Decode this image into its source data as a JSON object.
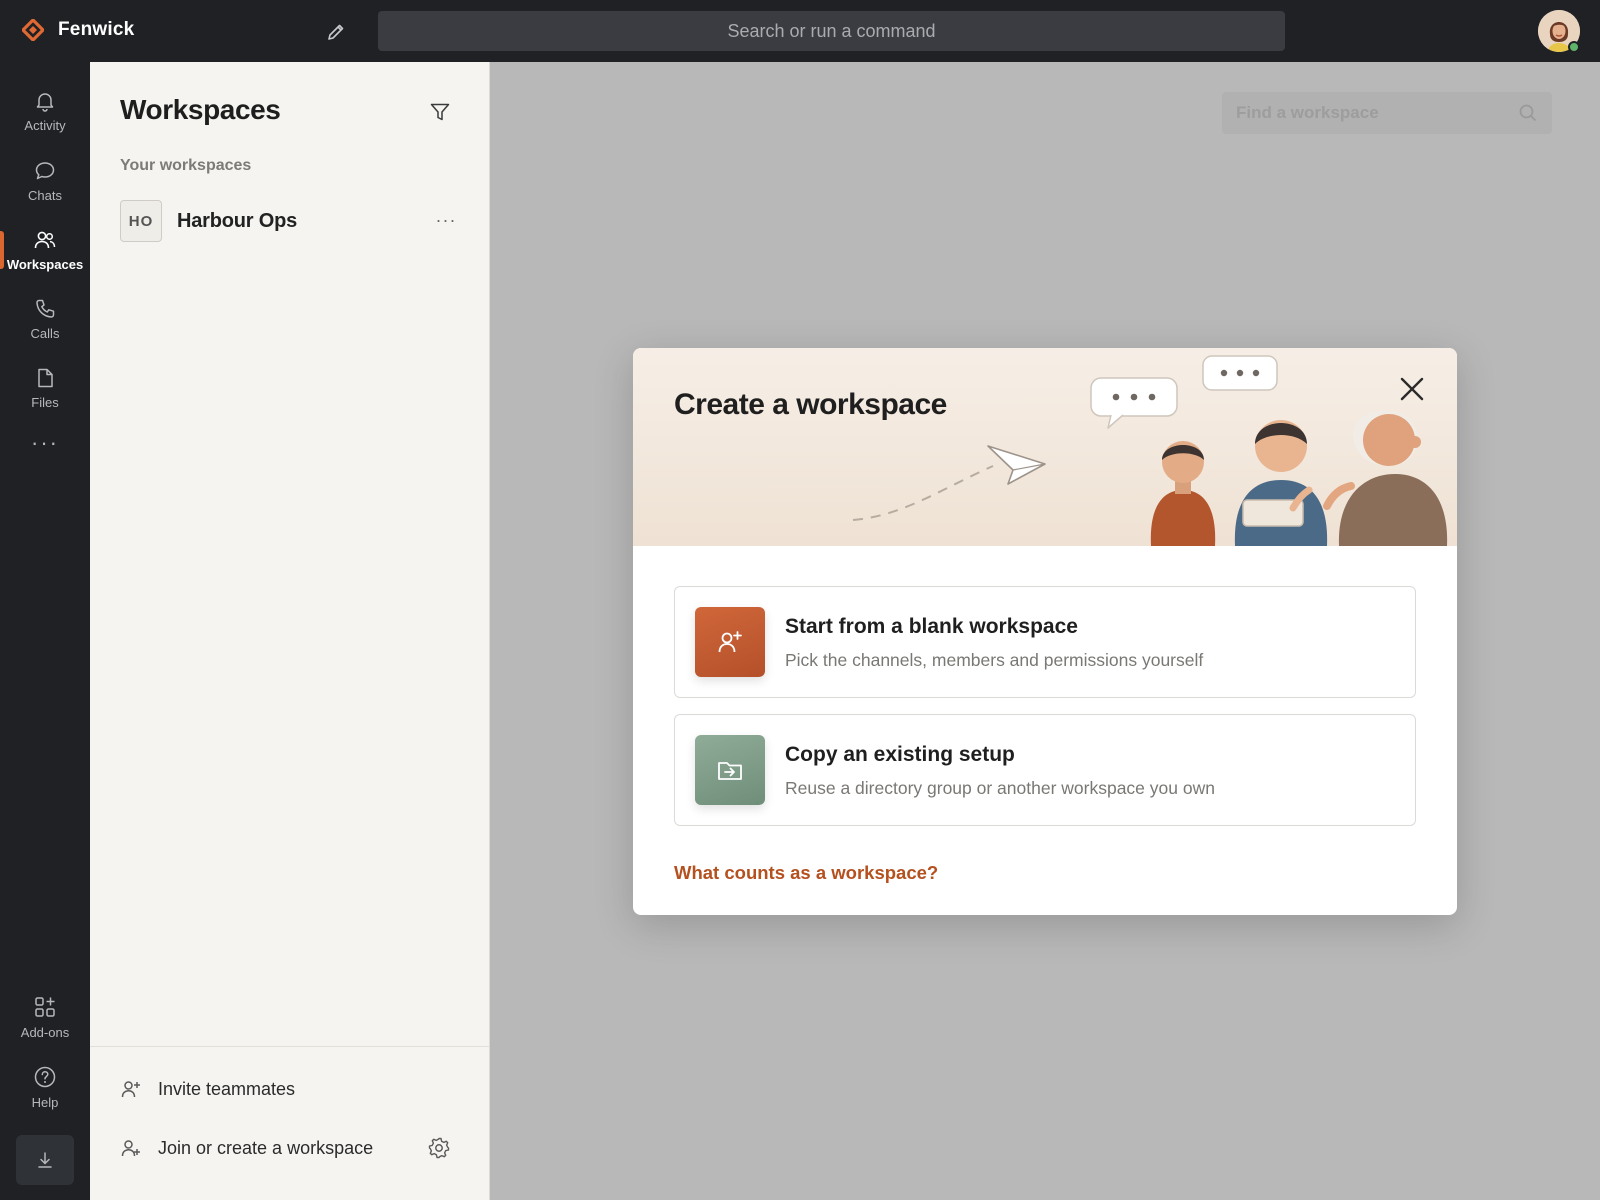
{
  "app": {
    "name": "Fenwick",
    "search_placeholder": "Search or run a command",
    "accent_color": "#d9672f",
    "topbar_color": "#1f2125"
  },
  "rail": {
    "items": [
      {
        "label": "Activity",
        "icon": "bell-icon"
      },
      {
        "label": "Chats",
        "icon": "chat-bubble-icon"
      },
      {
        "label": "Workspaces",
        "icon": "people-icon",
        "active": true
      },
      {
        "label": "Calls",
        "icon": "phone-icon"
      },
      {
        "label": "Files",
        "icon": "file-icon"
      }
    ],
    "more_label": "···",
    "bottom_items": [
      {
        "label": "Add-ons",
        "icon": "apps-grid-icon"
      },
      {
        "label": "Help",
        "icon": "help-circle-icon"
      }
    ]
  },
  "panel": {
    "title": "Workspaces",
    "section_label": "Your workspaces",
    "workspaces": [
      {
        "initials": "HO",
        "name": "Harbour Ops",
        "more": "···"
      }
    ],
    "footer": {
      "invite_label": "Invite teammates",
      "join_label": "Join or create a workspace"
    }
  },
  "main": {
    "find_placeholder": "Find a workspace"
  },
  "modal": {
    "title": "Create a workspace",
    "options": [
      {
        "title": "Start from a blank workspace",
        "description": "Pick the channels, members and permissions yourself",
        "icon": "add-person-icon",
        "color": "#c4592b"
      },
      {
        "title": "Copy an existing setup",
        "description": "Reuse a directory group or another workspace you own",
        "icon": "folder-import-icon",
        "color": "#7f9e88"
      }
    ],
    "help_link": "What counts as a workspace?"
  }
}
